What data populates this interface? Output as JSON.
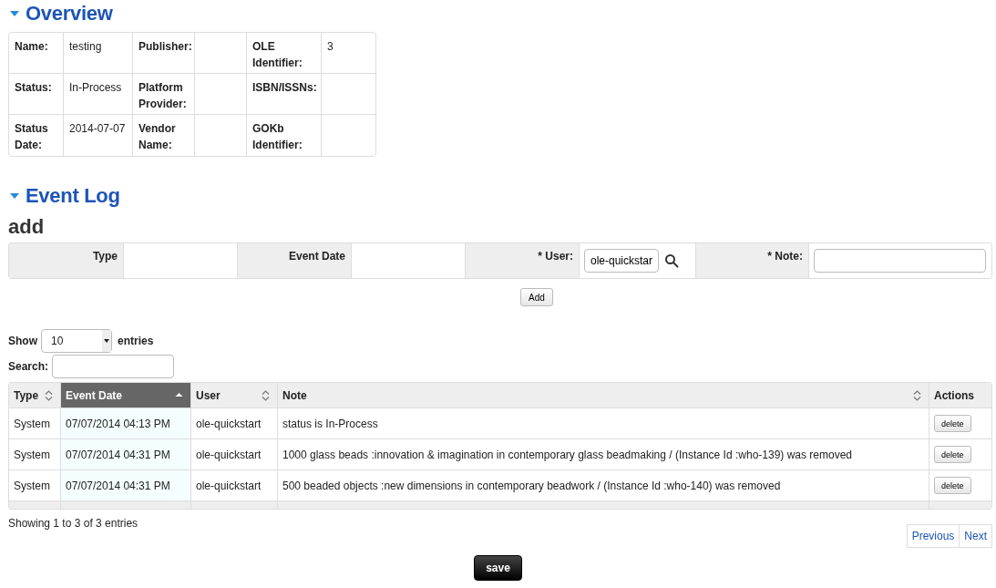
{
  "overview": {
    "title": "Overview",
    "expanded": true,
    "fields": [
      {
        "label": "Name:",
        "value": "testing"
      },
      {
        "label": "Publisher:"
      },
      {
        "label": "OLE Identifier:",
        "value": "3"
      },
      {
        "label": "Status:",
        "value": "In-Process"
      },
      {
        "label": "Platform Provider:"
      },
      {
        "label": "ISBN/ISSNs:"
      },
      {
        "label": "Status Date:",
        "value": "2014-07-07"
      },
      {
        "label": "Vendor Name:"
      },
      {
        "label": "GOKb Identifier:"
      }
    ]
  },
  "event_log": {
    "title": "Event Log",
    "expanded": true,
    "subtitle": "add",
    "add_form": [
      {
        "label": "Type",
        "kind": "blank"
      },
      {
        "label": "Event Date",
        "kind": "blank"
      },
      {
        "label": "* User:",
        "kind": "lookup",
        "value": "ole-quickstar"
      },
      {
        "label": "* Note:",
        "kind": "input"
      }
    ],
    "add_button": "Add",
    "show_label": "Show",
    "page_size": "10",
    "entries_label": "entries",
    "search_label": "Search:",
    "columns": [
      {
        "label": "Type",
        "sortable": true,
        "selected": false
      },
      {
        "label": "Event Date",
        "sortable": true,
        "selected": true
      },
      {
        "label": "User",
        "sortable": true,
        "selected": false
      },
      {
        "label": "Note",
        "sortable": true,
        "selected": false
      },
      {
        "label": "Actions",
        "sortable": false,
        "selected": false
      }
    ],
    "rows": [
      {
        "type": "System",
        "date": "07/07/2014 04:13 PM",
        "user": "ole-quickstart",
        "note": "status is In-Process",
        "action": "delete"
      },
      {
        "type": "System",
        "date": "07/07/2014 04:31 PM",
        "user": "ole-quickstart",
        "note": "1000 glass beads :innovation & imagination in contemporary glass beadmaking / (Instance Id :who-139) was removed",
        "action": "delete"
      },
      {
        "type": "System",
        "date": "07/07/2014 04:31 PM",
        "user": "ole-quickstart",
        "note": "500 beaded objects :new dimensions in contemporary beadwork / (Instance Id :who-140) was removed",
        "action": "delete"
      }
    ],
    "info": "Showing 1 to 3 of 3 entries",
    "pager": [
      "Previous",
      "Next"
    ]
  },
  "save_button": "save"
}
